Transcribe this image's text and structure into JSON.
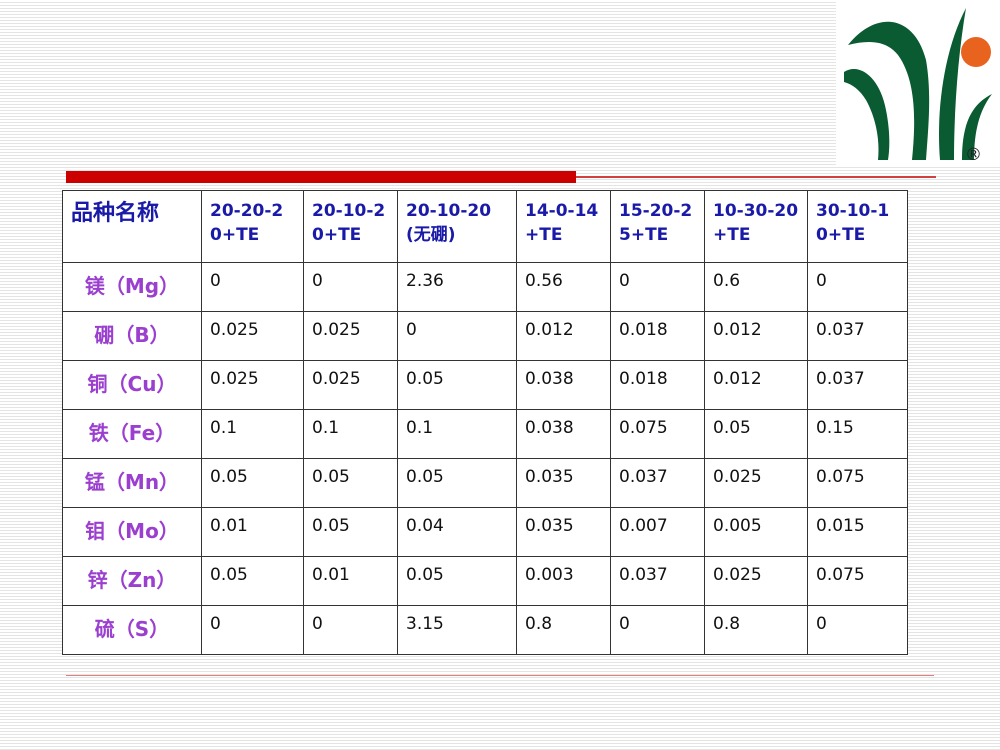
{
  "table": {
    "corner": "品种名称",
    "columns": [
      "20-20-20+TE",
      "20-10-20+TE",
      "20-10-20(无硼)",
      "14-0-14+TE",
      "15-20-25+TE",
      "10-30-20+TE",
      "30-10-10+TE"
    ],
    "rows": [
      {
        "label": "镁（Mg）",
        "values": [
          "0",
          "0",
          "2.36",
          "0.56",
          "0",
          "0.6",
          "0"
        ]
      },
      {
        "label": "硼（B）",
        "values": [
          "0.025",
          "0.025",
          "0",
          "0.012",
          "0.018",
          "0.012",
          "0.037"
        ]
      },
      {
        "label": "铜（Cu）",
        "values": [
          "0.025",
          "0.025",
          "0.05",
          "0.038",
          "0.018",
          "0.012",
          "0.037"
        ]
      },
      {
        "label": "铁（Fe）",
        "values": [
          "0.1",
          "0.1",
          "0.1",
          "0.038",
          "0.075",
          "0.05",
          "0.15"
        ]
      },
      {
        "label": "锰（Mn）",
        "values": [
          "0.05",
          "0.05",
          "0.05",
          "0.035",
          "0.037",
          "0.025",
          "0.075"
        ]
      },
      {
        "label": "钼（Mo）",
        "values": [
          "0.01",
          "0.05",
          "0.04",
          "0.035",
          "0.007",
          "0.005",
          "0.015"
        ]
      },
      {
        "label": "锌（Zn）",
        "values": [
          "0.05",
          "0.01",
          "0.05",
          "0.003",
          "0.037",
          "0.025",
          "0.075"
        ]
      },
      {
        "label": "硫（S）",
        "values": [
          "0",
          "0",
          "3.15",
          "0.8",
          "0",
          "0.8",
          "0"
        ]
      }
    ]
  },
  "logo": {
    "registered_mark": "®",
    "colors": {
      "green": "#0a5a32",
      "orange": "#e8641e"
    }
  },
  "colors": {
    "accent_bar": "#cc0000",
    "header_text": "#1a1aa8",
    "row_label_text": "#9b3fcf"
  }
}
